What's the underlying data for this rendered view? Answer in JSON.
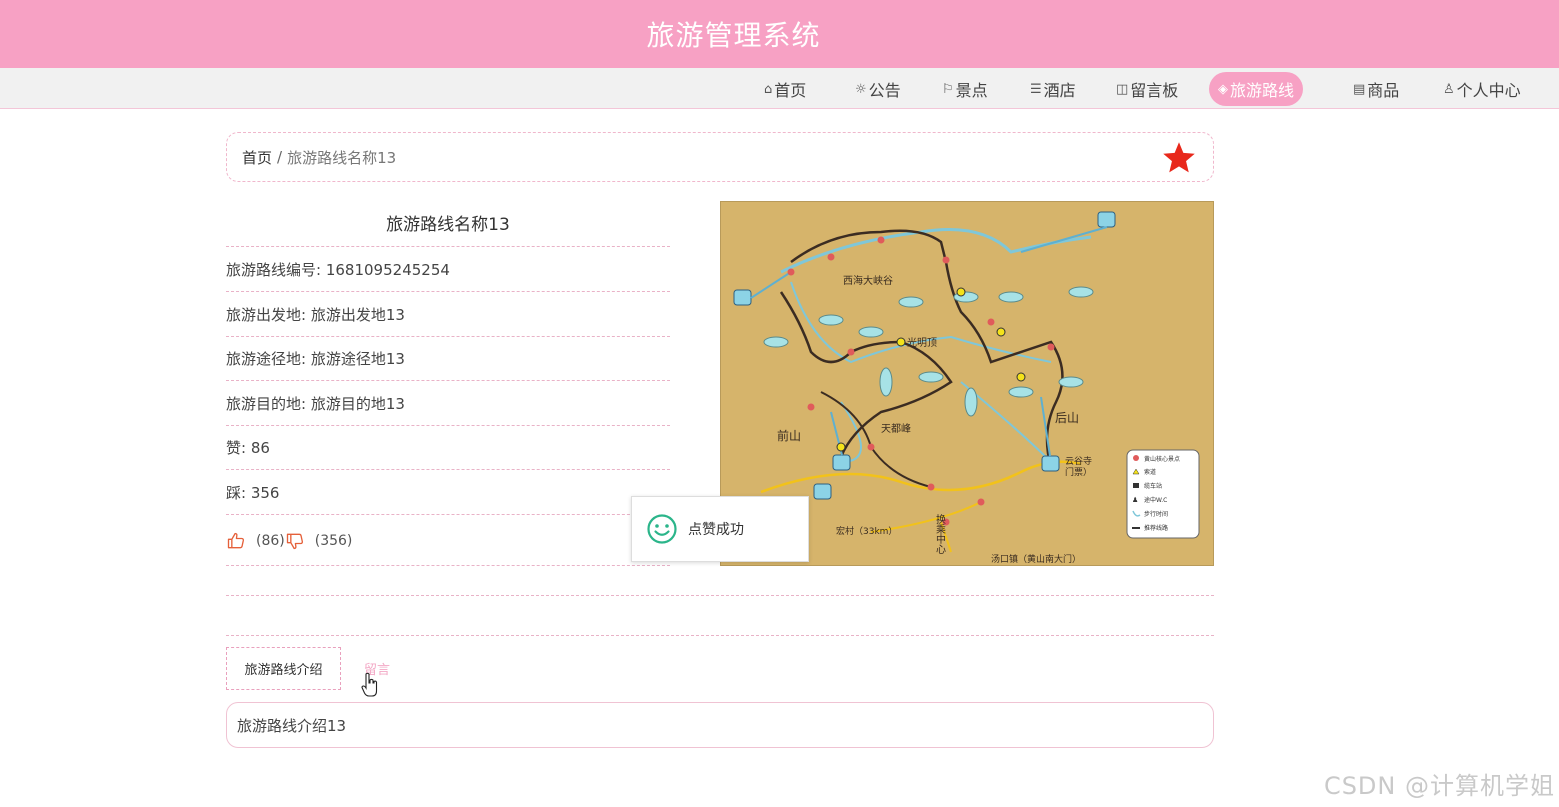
{
  "app": {
    "title": "旅游管理系统"
  },
  "nav": {
    "items": [
      {
        "label": "首页",
        "icon": "home-icon",
        "active": false
      },
      {
        "label": "公告",
        "icon": "announcement-icon",
        "active": false
      },
      {
        "label": "景点",
        "icon": "flag-icon",
        "active": false
      },
      {
        "label": "酒店",
        "icon": "hotel-icon",
        "active": false
      },
      {
        "label": "留言板",
        "icon": "message-board-icon",
        "active": false
      },
      {
        "label": "旅游路线",
        "icon": "route-icon",
        "active": true
      },
      {
        "label": "商品",
        "icon": "goods-icon",
        "active": false
      },
      {
        "label": "个人中心",
        "icon": "user-icon",
        "active": false
      }
    ]
  },
  "breadcrumb": {
    "home": "首页",
    "separator": "/",
    "current": "旅游路线名称13"
  },
  "detail": {
    "title": "旅游路线名称13",
    "fields": [
      {
        "label": "旅游路线编号:",
        "value": "1681095245254"
      },
      {
        "label": "旅游出发地:",
        "value": "旅游出发地13"
      },
      {
        "label": "旅游途径地:",
        "value": "旅游途径地13"
      },
      {
        "label": "旅游目的地:",
        "value": "旅游目的地13"
      },
      {
        "label": "赞:",
        "value": "86"
      },
      {
        "label": "踩:",
        "value": "356"
      }
    ],
    "like_count": "(86)",
    "dislike_count": "(356)"
  },
  "map": {
    "labels": {
      "west_canyon": "西海大峡谷",
      "guangming": "光明顶",
      "tiandu": "天都峰",
      "front": "前山",
      "back": "后山",
      "yungu": "云谷寺",
      "yungu_gate": "门票）",
      "hongcun": "宏村（33km）",
      "transfer": "换乘中心",
      "tangkou": "汤口镇（黄山南大门）"
    },
    "legend": [
      "黄山核心景点",
      "索道",
      "缆车站",
      "途中W.C",
      "步行时间",
      "推荐线路"
    ]
  },
  "toast": {
    "message": "点赞成功",
    "icon": "smile-icon"
  },
  "tabs": {
    "intro": "旅游路线介绍",
    "message": "留言"
  },
  "intro_text": "旅游路线介绍13",
  "watermark": "CSDN @计算机学姐",
  "colors": {
    "brand": "#f7a1c4",
    "star": "#e8281b",
    "toast_icon": "#2bb58a",
    "thumb": "#e5603a"
  }
}
